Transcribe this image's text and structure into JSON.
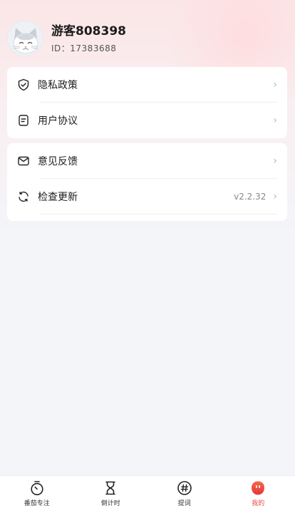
{
  "profile": {
    "username": "游客808398",
    "id_text": "ID：17383688",
    "avatar_icon": "cat-avatar"
  },
  "menu_group_1": [
    {
      "label": "隐私政策",
      "icon": "shield-check-icon"
    },
    {
      "label": "用户协议",
      "icon": "document-icon"
    }
  ],
  "menu_group_2": [
    {
      "label": "意见反馈",
      "icon": "mail-icon"
    },
    {
      "label": "检查更新",
      "icon": "refresh-icon",
      "value": "v2.2.32"
    }
  ],
  "chevron": "›",
  "tabbar": {
    "items": [
      {
        "label": "番茄专注",
        "icon": "stopwatch-icon"
      },
      {
        "label": "倒计时",
        "icon": "hourglass-icon"
      },
      {
        "label": "提词",
        "icon": "hashtag-icon"
      },
      {
        "label": "我的",
        "icon": "profile-face-icon",
        "active": true
      }
    ]
  },
  "colors": {
    "accent": "#e8483f",
    "background": "#f4f5f9",
    "card": "#ffffff",
    "header_tint": "#fbe6e7"
  }
}
